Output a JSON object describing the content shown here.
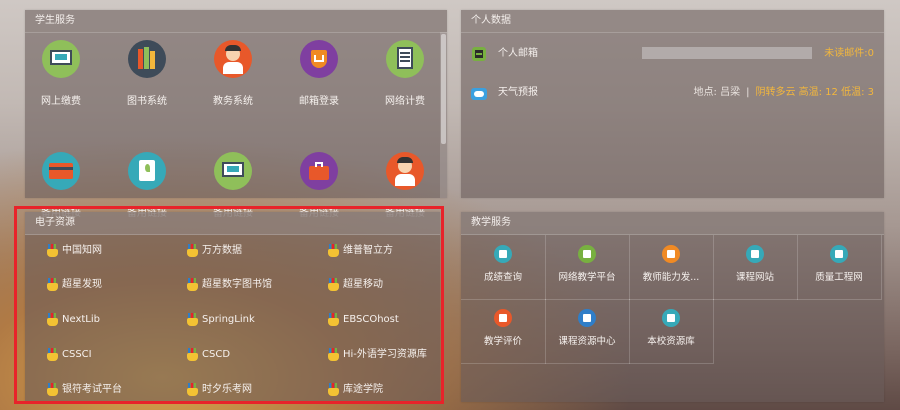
{
  "student_services": {
    "title": "学生服务",
    "items": [
      {
        "label": "网上缴费",
        "icon": "online-payment-icon",
        "color": "#8fbf5a"
      },
      {
        "label": "图书系统",
        "icon": "library-books-icon",
        "color": "#3e4b59"
      },
      {
        "label": "教务系统",
        "icon": "academic-affairs-icon",
        "color": "#e8582a"
      },
      {
        "label": "邮箱登录",
        "icon": "mail-login-icon",
        "color": "#7f3fa0"
      },
      {
        "label": "网络计费",
        "icon": "network-billing-icon",
        "color": "#8fbf5a"
      },
      {
        "label": "备用链接",
        "icon": "bank-card-icon",
        "color": "#36a9b8"
      },
      {
        "label": "备用链接",
        "icon": "plant-document-icon",
        "color": "#36a9b8"
      },
      {
        "label": "备用链接",
        "icon": "online-payment-icon",
        "color": "#8fbf5a"
      },
      {
        "label": "备用链接",
        "icon": "briefcase-icon",
        "color": "#7f3fa0"
      },
      {
        "label": "备用链接",
        "icon": "academic-affairs-icon",
        "color": "#e8582a"
      }
    ]
  },
  "personal_data": {
    "title": "个人数据",
    "mail": {
      "label": "个人邮箱",
      "unread": "未读邮件:0",
      "icon": "mail-box-icon",
      "color": "#78b040"
    },
    "weather": {
      "label": "天气预报",
      "location": "地点: 吕梁",
      "divider": "|",
      "forecast": "阴转多云 高温: 12 低温: 3",
      "icon": "cloud-weather-icon",
      "color": "#3aa0e0"
    }
  },
  "resources": {
    "title": "电子资源",
    "items": [
      [
        "中国知网",
        "万方数据",
        "维普智立方"
      ],
      [
        "超星发现",
        "超星数字图书馆",
        "超星移动"
      ],
      [
        "NextLib",
        "SpringLink",
        "EBSCOhost"
      ],
      [
        "CSSCI",
        "CSCD",
        "Hi-外语学习资源库"
      ],
      [
        "银符考试平台",
        "时夕乐考网",
        "库途学院"
      ]
    ],
    "hand_icon": "pointing-hand-icon"
  },
  "teaching_services": {
    "title": "教学服务",
    "items": [
      {
        "label": "成绩查询",
        "icon": "grade-query-icon",
        "color": "#36a9b8"
      },
      {
        "label": "网络教学平台",
        "icon": "network-teaching-icon",
        "color": "#78b040"
      },
      {
        "label": "教师能力发...",
        "icon": "teacher-development-icon",
        "color": "#f08a24"
      },
      {
        "label": "课程网站",
        "icon": "course-website-icon",
        "color": "#36a9b8"
      },
      {
        "label": "质量工程网",
        "icon": "quality-engineering-icon",
        "color": "#36a9b8"
      },
      {
        "label": "教学评价",
        "icon": "teaching-evaluation-icon",
        "color": "#e8582a"
      },
      {
        "label": "课程资源中心",
        "icon": "course-resource-icon",
        "color": "#2f7ec8"
      },
      {
        "label": "本校资源库",
        "icon": "school-resource-icon",
        "color": "#36a9b8"
      }
    ]
  }
}
